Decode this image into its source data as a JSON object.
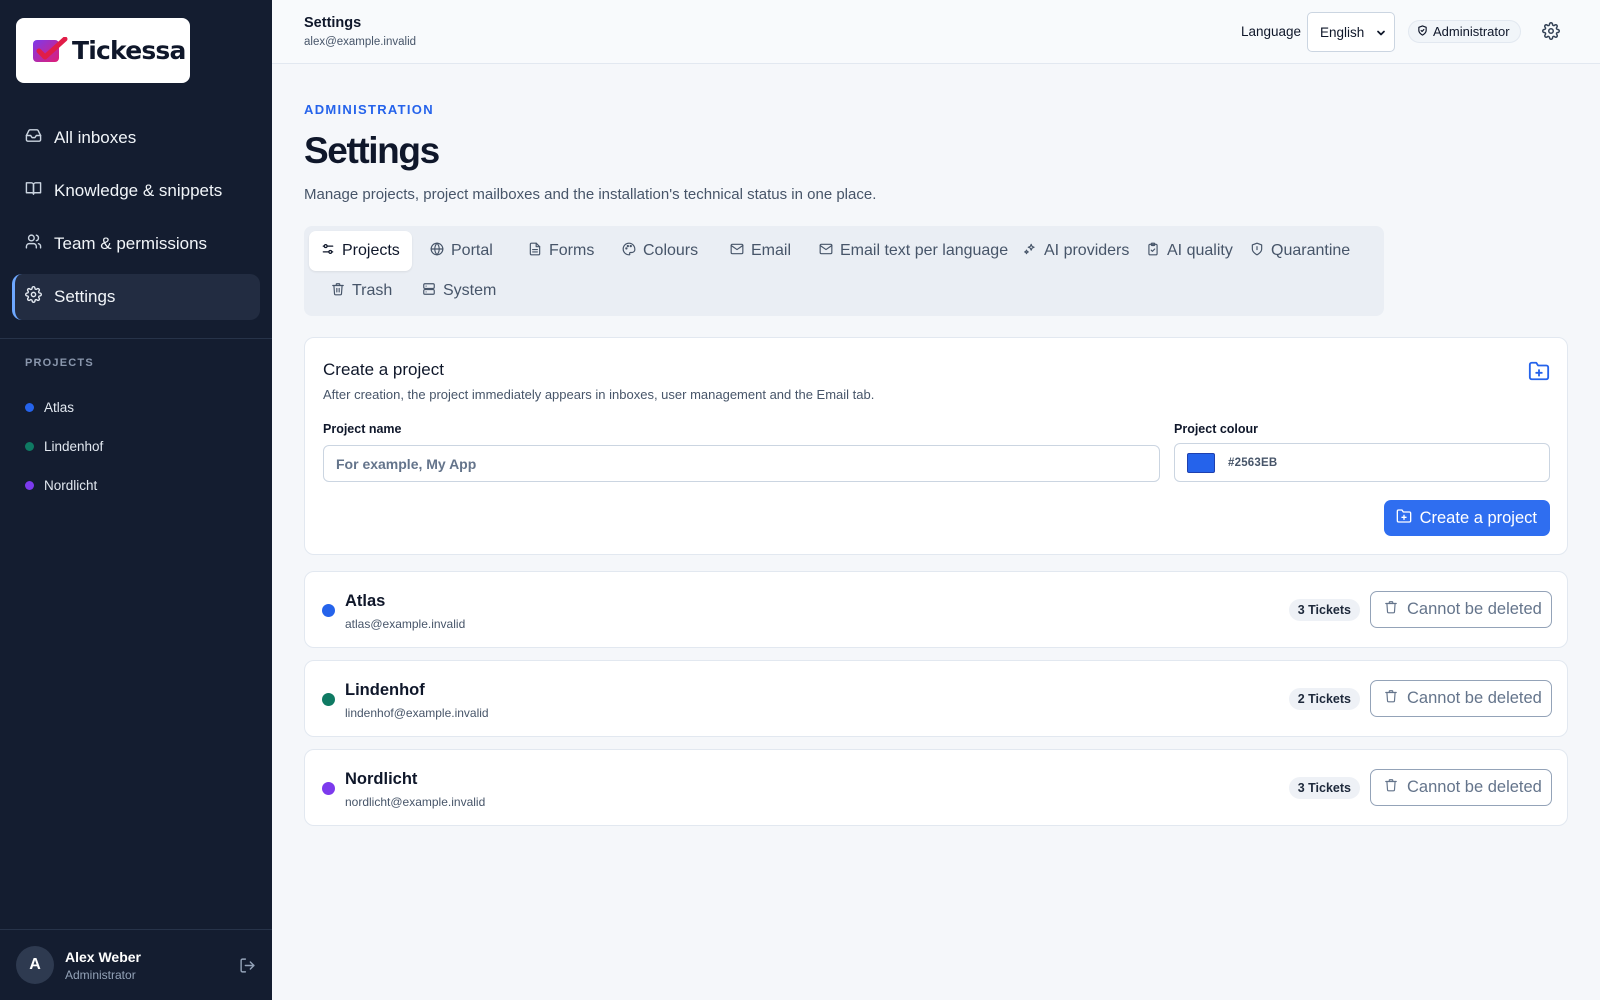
{
  "brand": {
    "name": "Tickessa"
  },
  "sidebar": {
    "nav": [
      {
        "label": "All inboxes",
        "icon": "inbox-icon"
      },
      {
        "label": "Knowledge & snippets",
        "icon": "book-icon"
      },
      {
        "label": "Team & permissions",
        "icon": "users-icon"
      },
      {
        "label": "Settings",
        "icon": "gear-icon",
        "active": true
      }
    ],
    "projects_heading": "PROJECTS",
    "projects": [
      {
        "name": "Atlas",
        "color": "#2563eb"
      },
      {
        "name": "Lindenhof",
        "color": "#0f7a63"
      },
      {
        "name": "Nordlicht",
        "color": "#7c3aed"
      }
    ],
    "user": {
      "initial": "A",
      "name": "Alex Weber",
      "role": "Administrator"
    }
  },
  "topbar": {
    "title": "Settings",
    "email": "alex@example.invalid",
    "language_label": "Language",
    "language_value": "English",
    "role_badge": "Administrator"
  },
  "page": {
    "eyebrow": "ADMINISTRATION",
    "title": "Settings",
    "subtitle": "Manage projects, project mailboxes and the installation's technical status in one place."
  },
  "tabs": [
    {
      "label": "Projects",
      "icon": "sliders-icon",
      "active": true
    },
    {
      "label": "Portal",
      "icon": "globe-icon"
    },
    {
      "label": "Forms",
      "icon": "document-icon"
    },
    {
      "label": "Colours",
      "icon": "palette-icon"
    },
    {
      "label": "Email",
      "icon": "mail-icon"
    },
    {
      "label": "Email text per language",
      "icon": "mail-icon"
    },
    {
      "label": "AI providers",
      "icon": "sparkle-icon"
    },
    {
      "label": "AI quality",
      "icon": "clipboard-check-icon"
    },
    {
      "label": "Quarantine",
      "icon": "shield-icon"
    },
    {
      "label": "Trash",
      "icon": "trash-icon"
    },
    {
      "label": "System",
      "icon": "server-icon"
    }
  ],
  "create_project": {
    "title": "Create a project",
    "description": "After creation, the project immediately appears in inboxes, user management and the Email tab.",
    "name_label": "Project name",
    "name_placeholder": "For example, My App",
    "color_label": "Project colour",
    "color_value": "#2563EB",
    "submit_label": "Create a project"
  },
  "project_cards": [
    {
      "name": "Atlas",
      "email": "atlas@example.invalid",
      "tickets": "3 Tickets",
      "action": "Cannot be deleted",
      "color": "#2563eb"
    },
    {
      "name": "Lindenhof",
      "email": "lindenhof@example.invalid",
      "tickets": "2 Tickets",
      "action": "Cannot be deleted",
      "color": "#0f7a63"
    },
    {
      "name": "Nordlicht",
      "email": "nordlicht@example.invalid",
      "tickets": "3 Tickets",
      "action": "Cannot be deleted",
      "color": "#7c3aed"
    }
  ]
}
